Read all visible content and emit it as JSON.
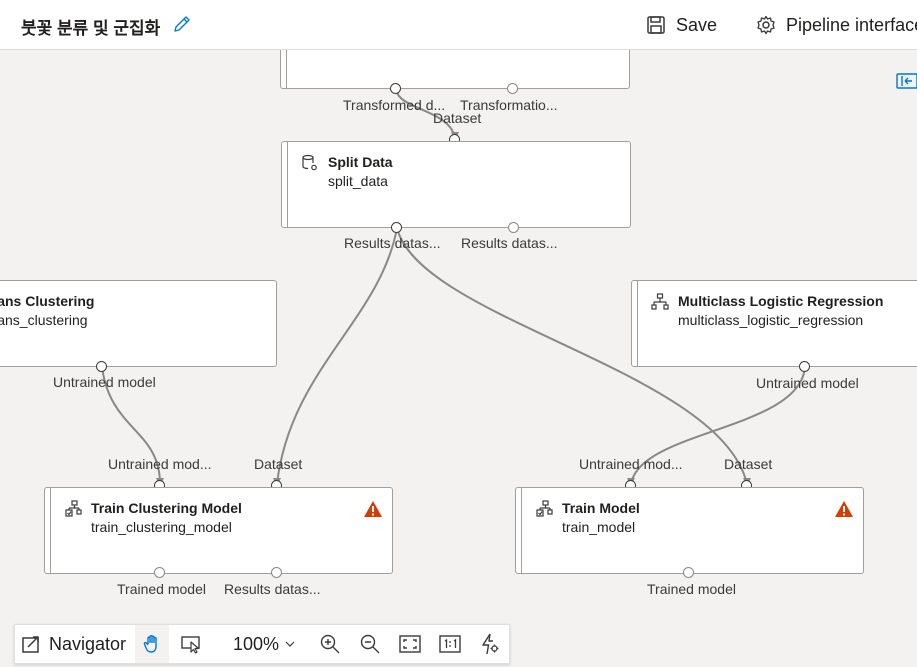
{
  "header": {
    "title": "붓꽃 분류 및 군집화",
    "save_label": "Save",
    "pipeline_label": "Pipeline interface"
  },
  "nodes": {
    "top_partial": {
      "out1": "Transformed d...",
      "out2": "Transformatio..."
    },
    "split_data": {
      "in1": "Dataset",
      "name": "Split Data",
      "id": "split_data",
      "out1": "Results datas...",
      "out2": "Results datas..."
    },
    "kmeans": {
      "name": "K-Means Clustering",
      "id": "k_means_clustering",
      "out1": "Untrained model"
    },
    "mlr": {
      "name": "Multiclass Logistic Regression",
      "id": "multiclass_logistic_regression",
      "out1": "Untrained model"
    },
    "train_clustering": {
      "in1": "Untrained mod...",
      "in2": "Dataset",
      "name": "Train Clustering Model",
      "id": "train_clustering_model",
      "out1": "Trained model",
      "out2": "Results datas..."
    },
    "train_model": {
      "in1": "Untrained mod...",
      "in2": "Dataset",
      "name": "Train Model",
      "id": "train_model",
      "out1": "Trained model"
    }
  },
  "toolbar": {
    "navigator_label": "Navigator",
    "zoom": "100%"
  },
  "colors": {
    "warning": "#d83b01",
    "accent": "#0078d4"
  }
}
